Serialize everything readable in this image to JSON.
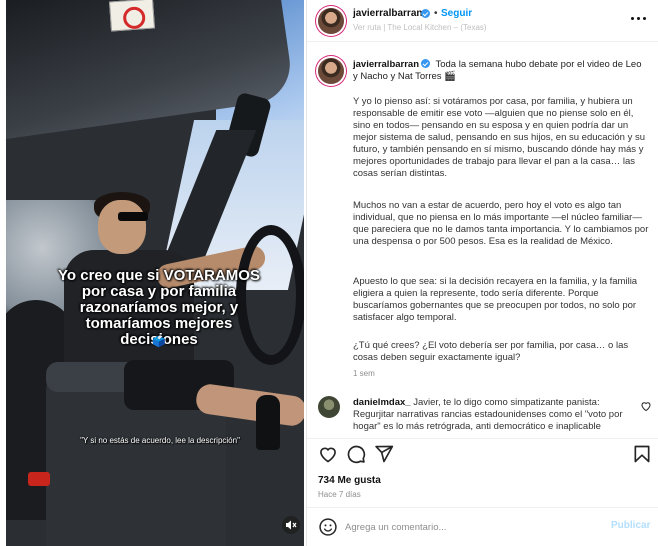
{
  "media": {
    "overlay_caption": "Yo creo que si VOTARAMOS por casa y por familia razonaríamos mejor, y tomaríamos mejores decisiones",
    "overlay_emoji": "🗳️",
    "overlay_subcaption": "\"Y si no estás de acuerdo, lee la descripción\"",
    "mute_icon": "speaker-muted-icon"
  },
  "header": {
    "username": "javierralbarran",
    "separator": "•",
    "follow_label": "Seguir",
    "location": "Ver ruta | The Local Kitchen – (Texas)"
  },
  "caption": {
    "username": "javierralbarran",
    "intro": "Toda la semana hubo debate por el video de Leo y Nacho y Nat Torres 🎬",
    "paragraphs": [
      "Y yo lo pienso así: si votáramos por casa, por familia, y hubiera un responsable de emitir ese voto —alguien que no piense solo en él, sino en todos— pensando en su esposa y en quien podría dar un mejor sistema de salud, pensando en sus hijos, en su educación y su futuro, y también pensando en sí mismo, buscando dónde hay más y mejores oportunidades de trabajo para llevar el pan a la casa… las cosas serían distintas.",
      "Muchos no van a estar de acuerdo, pero hoy el voto es algo tan individual, que no piensa en lo más importante —el núcleo familiar— que pareciera que no le damos tanta importancia. Y lo cambiamos por una despensa o por 500 pesos. Esa es la realidad de México.",
      "Apuesto lo que sea: si la decisión recayera en la familia, y la familia eligiera a quien la represente, todo sería diferente. Porque buscaríamos gobernantes que se preocupen por todos, no solo por satisfacer algo temporal.",
      "¿Tú qué crees? ¿El voto debería ser por familia, por casa… o las cosas deben seguir exactamente igual?"
    ],
    "time": "1 sem"
  },
  "comment": {
    "username": "danielmdax_",
    "text": "Javier, te lo digo como simpatizante panista: Regurjitar narrativas rancias estadounidenses como el \"voto por hogar\" es lo más retrógrada, anti democrático e inaplicable"
  },
  "actions": {
    "like_icon": "heart-icon",
    "comment_icon": "comment-icon",
    "share_icon": "send-icon",
    "save_icon": "bookmark-icon"
  },
  "stats": {
    "likes": "734 Me gusta",
    "ago": "Hace 7 días"
  },
  "add_comment": {
    "placeholder": "Agrega un comentario...",
    "post_label": "Publicar"
  },
  "colors": {
    "accent": "#0095f6",
    "verified": "#3897f0",
    "muted_text": "#8e8e8e",
    "post_disabled": "#b2dffc"
  }
}
